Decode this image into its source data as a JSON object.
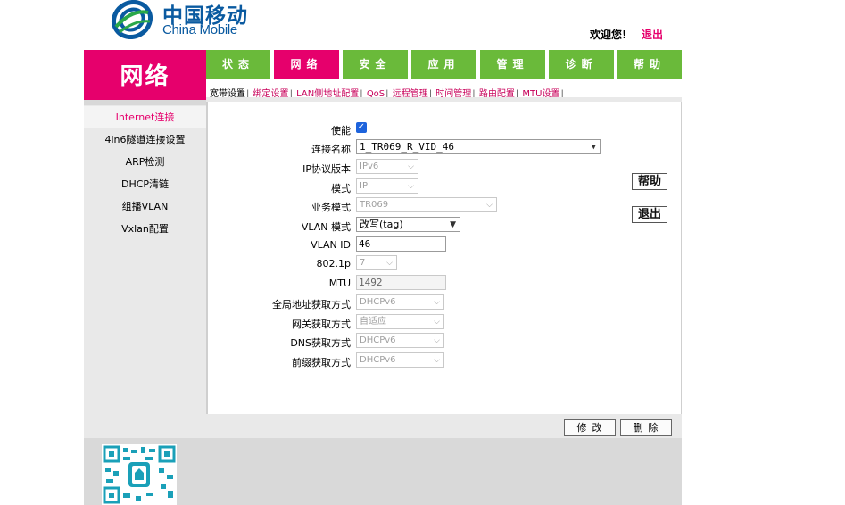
{
  "header": {
    "brand_cn": "中国移动",
    "brand_en": "China Mobile",
    "welcome": "欢迎您!",
    "logout": "退出"
  },
  "section_title": "网络",
  "main_nav": [
    {
      "label": "状态",
      "active": false
    },
    {
      "label": "网络",
      "active": true
    },
    {
      "label": "安全",
      "active": false
    },
    {
      "label": "应用",
      "active": false
    },
    {
      "label": "管理",
      "active": false
    },
    {
      "label": "诊断",
      "active": false
    },
    {
      "label": "帮助",
      "active": false
    }
  ],
  "sub_nav": [
    "宽带设置",
    "绑定设置",
    "LAN侧地址配置",
    "QoS",
    "远程管理",
    "时间管理",
    "路由配置",
    "MTU设置"
  ],
  "sidebar": {
    "items": [
      {
        "label": "Internet连接",
        "active": true
      },
      {
        "label": "4in6隧道连接设置",
        "active": false
      },
      {
        "label": "ARP检测",
        "active": false
      },
      {
        "label": "DHCP清链",
        "active": false
      },
      {
        "label": "组播VLAN",
        "active": false
      },
      {
        "label": "Vxlan配置",
        "active": false
      }
    ]
  },
  "form": {
    "enable_label": "使能",
    "enable_checked": true,
    "conn_name_label": "连接名称",
    "conn_name_value": "1_TR069_R_VID_46",
    "ip_version_label": "IP协议版本",
    "ip_version_value": "IPv6",
    "mode_label": "模式",
    "mode_value": "IP",
    "service_mode_label": "业务模式",
    "service_mode_value": "TR069",
    "vlan_mode_label": "VLAN 模式",
    "vlan_mode_value": "改写(tag)",
    "vlan_id_label": "VLAN ID",
    "vlan_id_value": "46",
    "p8021_label": "802.1p",
    "p8021_value": "7",
    "mtu_label": "MTU",
    "mtu_value": "1492",
    "global_addr_label": "全局地址获取方式",
    "global_addr_value": "DHCPv6",
    "gateway_label": "网关获取方式",
    "gateway_value": "自适应",
    "dns_label": "DNS获取方式",
    "dns_value": "DHCPv6",
    "prefix_label": "前缀获取方式",
    "prefix_value": "DHCPv6"
  },
  "side_buttons": {
    "help": "帮助",
    "exit": "退出"
  },
  "actions": {
    "modify": "修改",
    "delete": "删除"
  },
  "colors": {
    "brand_pink": "#e6006c",
    "nav_green": "#6aba3a",
    "brand_blue": "#0a5aa0"
  }
}
